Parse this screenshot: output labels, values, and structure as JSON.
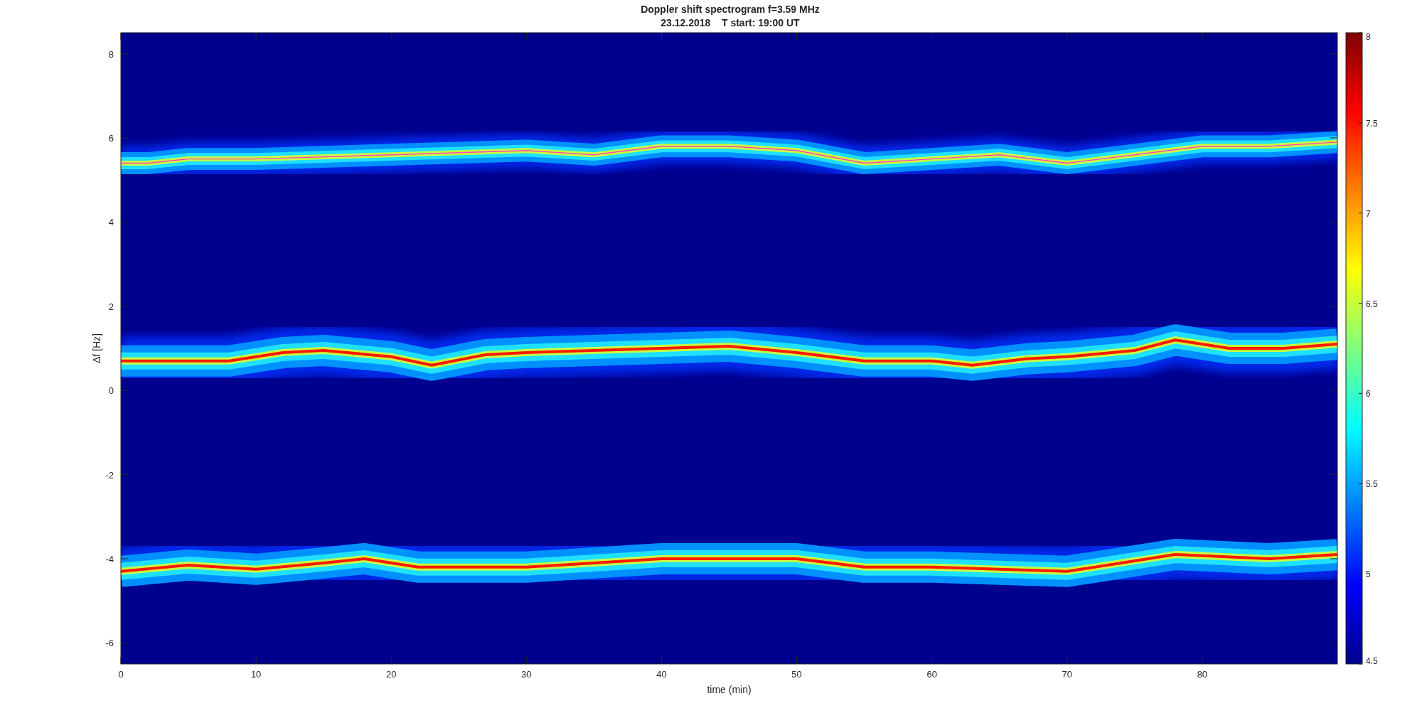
{
  "figure": {
    "title_lines": [
      "Doppler shift spectrogram f=3.59 MHz",
      "23.12.2018    T start: 19:00 UT"
    ]
  },
  "axes": {
    "xlabel": "time (min)",
    "ylabel": "Δf [Hz]",
    "xticks": [
      "0",
      "10",
      "20",
      "30",
      "40",
      "50",
      "60",
      "70",
      "80"
    ],
    "yticks": [
      "8",
      "6",
      "4",
      "2",
      "0",
      "-2",
      "-4",
      "-6"
    ]
  },
  "colorbar": {
    "ticks": [
      "8",
      "7.5",
      "7",
      "6.5",
      "6",
      "5.5",
      "5",
      "4.5"
    ]
  }
}
